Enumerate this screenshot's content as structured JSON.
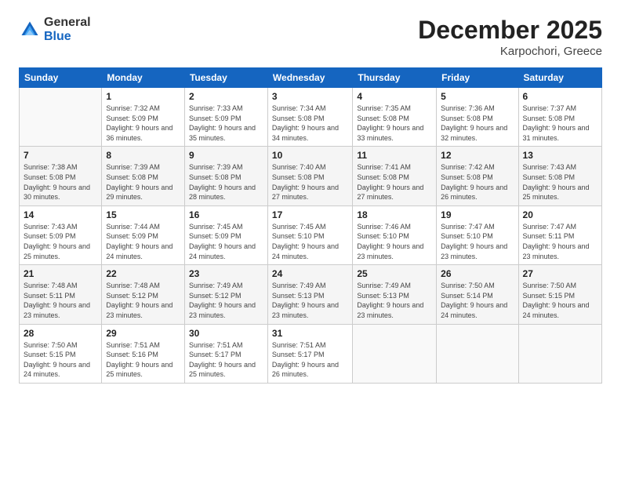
{
  "header": {
    "logo_general": "General",
    "logo_blue": "Blue",
    "month_title": "December 2025",
    "location": "Karpochori, Greece"
  },
  "days_of_week": [
    "Sunday",
    "Monday",
    "Tuesday",
    "Wednesday",
    "Thursday",
    "Friday",
    "Saturday"
  ],
  "weeks": [
    [
      {
        "num": "",
        "sunrise": "",
        "sunset": "",
        "daylight": ""
      },
      {
        "num": "1",
        "sunrise": "Sunrise: 7:32 AM",
        "sunset": "Sunset: 5:09 PM",
        "daylight": "Daylight: 9 hours and 36 minutes."
      },
      {
        "num": "2",
        "sunrise": "Sunrise: 7:33 AM",
        "sunset": "Sunset: 5:09 PM",
        "daylight": "Daylight: 9 hours and 35 minutes."
      },
      {
        "num": "3",
        "sunrise": "Sunrise: 7:34 AM",
        "sunset": "Sunset: 5:08 PM",
        "daylight": "Daylight: 9 hours and 34 minutes."
      },
      {
        "num": "4",
        "sunrise": "Sunrise: 7:35 AM",
        "sunset": "Sunset: 5:08 PM",
        "daylight": "Daylight: 9 hours and 33 minutes."
      },
      {
        "num": "5",
        "sunrise": "Sunrise: 7:36 AM",
        "sunset": "Sunset: 5:08 PM",
        "daylight": "Daylight: 9 hours and 32 minutes."
      },
      {
        "num": "6",
        "sunrise": "Sunrise: 7:37 AM",
        "sunset": "Sunset: 5:08 PM",
        "daylight": "Daylight: 9 hours and 31 minutes."
      }
    ],
    [
      {
        "num": "7",
        "sunrise": "Sunrise: 7:38 AM",
        "sunset": "Sunset: 5:08 PM",
        "daylight": "Daylight: 9 hours and 30 minutes."
      },
      {
        "num": "8",
        "sunrise": "Sunrise: 7:39 AM",
        "sunset": "Sunset: 5:08 PM",
        "daylight": "Daylight: 9 hours and 29 minutes."
      },
      {
        "num": "9",
        "sunrise": "Sunrise: 7:39 AM",
        "sunset": "Sunset: 5:08 PM",
        "daylight": "Daylight: 9 hours and 28 minutes."
      },
      {
        "num": "10",
        "sunrise": "Sunrise: 7:40 AM",
        "sunset": "Sunset: 5:08 PM",
        "daylight": "Daylight: 9 hours and 27 minutes."
      },
      {
        "num": "11",
        "sunrise": "Sunrise: 7:41 AM",
        "sunset": "Sunset: 5:08 PM",
        "daylight": "Daylight: 9 hours and 27 minutes."
      },
      {
        "num": "12",
        "sunrise": "Sunrise: 7:42 AM",
        "sunset": "Sunset: 5:08 PM",
        "daylight": "Daylight: 9 hours and 26 minutes."
      },
      {
        "num": "13",
        "sunrise": "Sunrise: 7:43 AM",
        "sunset": "Sunset: 5:08 PM",
        "daylight": "Daylight: 9 hours and 25 minutes."
      }
    ],
    [
      {
        "num": "14",
        "sunrise": "Sunrise: 7:43 AM",
        "sunset": "Sunset: 5:09 PM",
        "daylight": "Daylight: 9 hours and 25 minutes."
      },
      {
        "num": "15",
        "sunrise": "Sunrise: 7:44 AM",
        "sunset": "Sunset: 5:09 PM",
        "daylight": "Daylight: 9 hours and 24 minutes."
      },
      {
        "num": "16",
        "sunrise": "Sunrise: 7:45 AM",
        "sunset": "Sunset: 5:09 PM",
        "daylight": "Daylight: 9 hours and 24 minutes."
      },
      {
        "num": "17",
        "sunrise": "Sunrise: 7:45 AM",
        "sunset": "Sunset: 5:10 PM",
        "daylight": "Daylight: 9 hours and 24 minutes."
      },
      {
        "num": "18",
        "sunrise": "Sunrise: 7:46 AM",
        "sunset": "Sunset: 5:10 PM",
        "daylight": "Daylight: 9 hours and 23 minutes."
      },
      {
        "num": "19",
        "sunrise": "Sunrise: 7:47 AM",
        "sunset": "Sunset: 5:10 PM",
        "daylight": "Daylight: 9 hours and 23 minutes."
      },
      {
        "num": "20",
        "sunrise": "Sunrise: 7:47 AM",
        "sunset": "Sunset: 5:11 PM",
        "daylight": "Daylight: 9 hours and 23 minutes."
      }
    ],
    [
      {
        "num": "21",
        "sunrise": "Sunrise: 7:48 AM",
        "sunset": "Sunset: 5:11 PM",
        "daylight": "Daylight: 9 hours and 23 minutes."
      },
      {
        "num": "22",
        "sunrise": "Sunrise: 7:48 AM",
        "sunset": "Sunset: 5:12 PM",
        "daylight": "Daylight: 9 hours and 23 minutes."
      },
      {
        "num": "23",
        "sunrise": "Sunrise: 7:49 AM",
        "sunset": "Sunset: 5:12 PM",
        "daylight": "Daylight: 9 hours and 23 minutes."
      },
      {
        "num": "24",
        "sunrise": "Sunrise: 7:49 AM",
        "sunset": "Sunset: 5:13 PM",
        "daylight": "Daylight: 9 hours and 23 minutes."
      },
      {
        "num": "25",
        "sunrise": "Sunrise: 7:49 AM",
        "sunset": "Sunset: 5:13 PM",
        "daylight": "Daylight: 9 hours and 23 minutes."
      },
      {
        "num": "26",
        "sunrise": "Sunrise: 7:50 AM",
        "sunset": "Sunset: 5:14 PM",
        "daylight": "Daylight: 9 hours and 24 minutes."
      },
      {
        "num": "27",
        "sunrise": "Sunrise: 7:50 AM",
        "sunset": "Sunset: 5:15 PM",
        "daylight": "Daylight: 9 hours and 24 minutes."
      }
    ],
    [
      {
        "num": "28",
        "sunrise": "Sunrise: 7:50 AM",
        "sunset": "Sunset: 5:15 PM",
        "daylight": "Daylight: 9 hours and 24 minutes."
      },
      {
        "num": "29",
        "sunrise": "Sunrise: 7:51 AM",
        "sunset": "Sunset: 5:16 PM",
        "daylight": "Daylight: 9 hours and 25 minutes."
      },
      {
        "num": "30",
        "sunrise": "Sunrise: 7:51 AM",
        "sunset": "Sunset: 5:17 PM",
        "daylight": "Daylight: 9 hours and 25 minutes."
      },
      {
        "num": "31",
        "sunrise": "Sunrise: 7:51 AM",
        "sunset": "Sunset: 5:17 PM",
        "daylight": "Daylight: 9 hours and 26 minutes."
      },
      {
        "num": "",
        "sunrise": "",
        "sunset": "",
        "daylight": ""
      },
      {
        "num": "",
        "sunrise": "",
        "sunset": "",
        "daylight": ""
      },
      {
        "num": "",
        "sunrise": "",
        "sunset": "",
        "daylight": ""
      }
    ]
  ]
}
